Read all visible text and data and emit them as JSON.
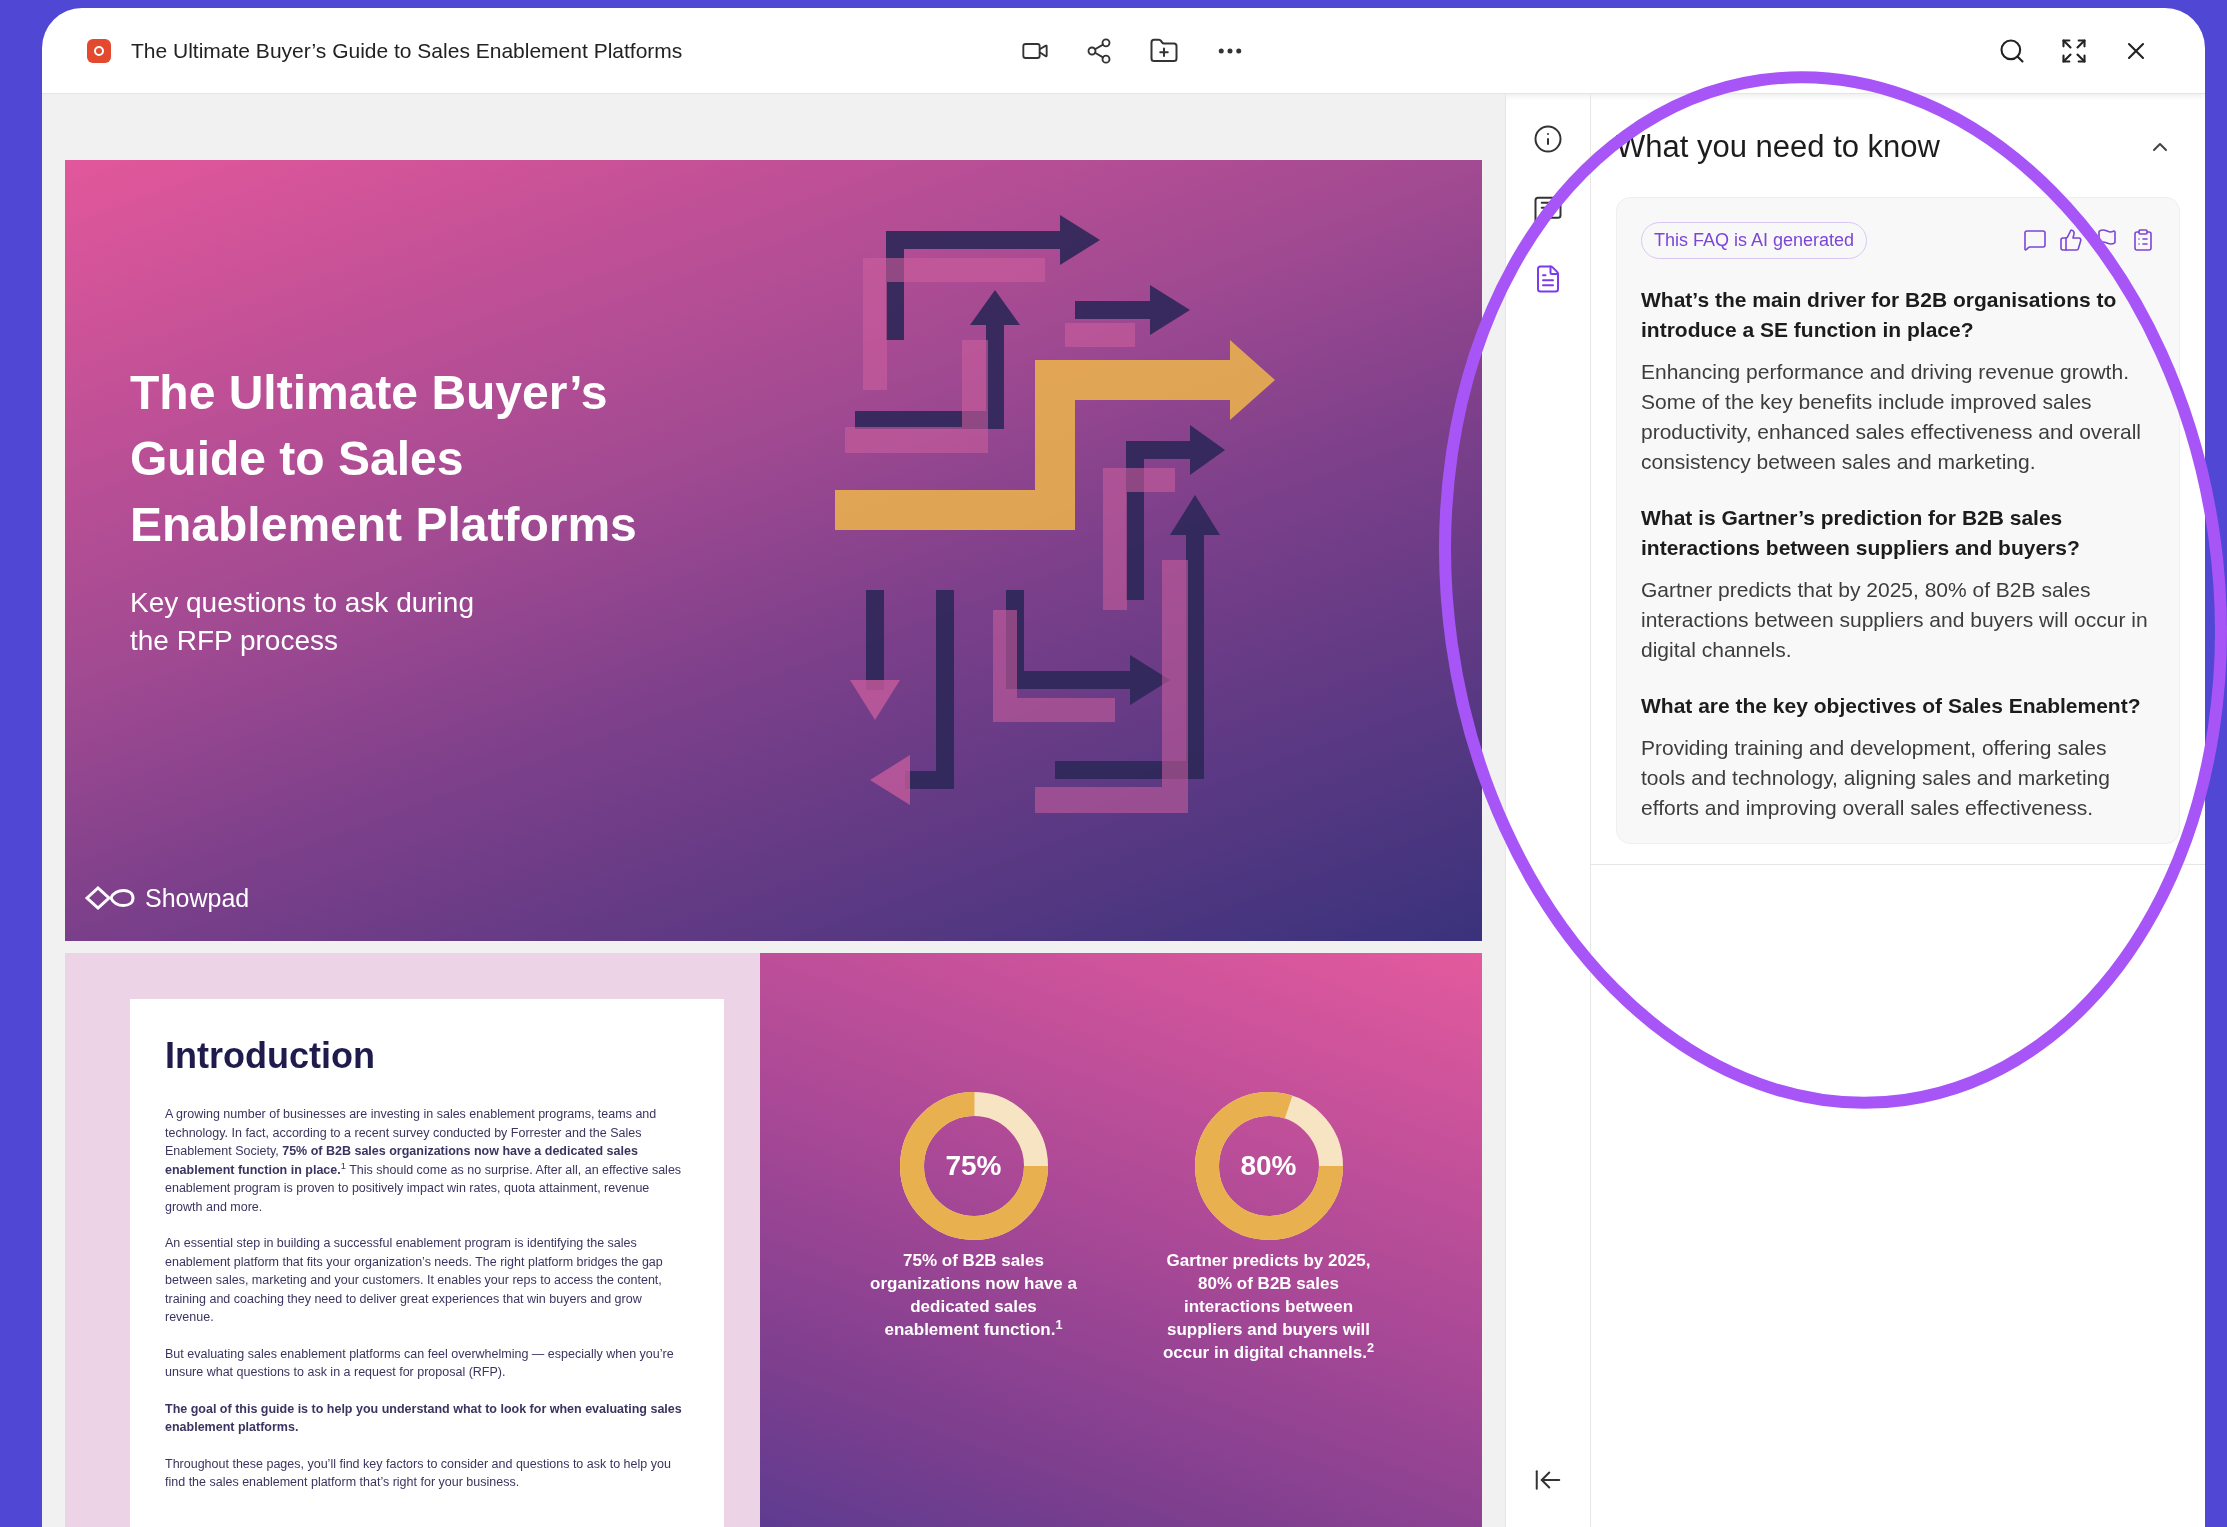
{
  "window": {
    "title": "The Ultimate Buyer’s Guide to Sales Enablement Platforms"
  },
  "document": {
    "cover": {
      "title_lines": [
        "The Ultimate Buyer’s",
        "Guide to Sales",
        "Enablement Platforms"
      ],
      "subtitle_lines": [
        "Key questions to ask during",
        "the RFP process"
      ],
      "brand": "Showpad"
    },
    "intro": {
      "heading": "Introduction",
      "paragraphs": [
        "A growing number of businesses are investing in sales enablement programs, teams and technology. In fact, according to a recent survey conducted by Forrester and the Sales Enablement Society, **75% of B2B sales organizations now have a dedicated sales enablement function in place.**$^{1}$ This should come as no surprise. After all, an effective sales enablement program is proven to positively impact win rates, quota attainment, revenue growth and more.",
        "An essential step in building a successful enablement program is identifying the sales enablement platform that fits your organization’s needs. The right platform bridges the gap between sales, marketing and your customers. It enables your reps to access the content, training and coaching they need to deliver great experiences that win buyers and grow revenue.",
        "But evaluating sales enablement platforms can feel overwhelming — especially when you’re unsure what questions to ask in a request for proposal (RFP).",
        "**The goal of this guide is to help you understand what to look for when evaluating sales enablement platforms.**",
        "Throughout these pages, you’ll find key factors to consider and questions to ask to help you find the sales enablement platform that’s right for your business."
      ]
    },
    "stats": [
      {
        "value": "75%",
        "level": 0.75,
        "caption": "75% of B2B sales organizations now have a dedicated sales enablement function.$^{1}$"
      },
      {
        "value": "80%",
        "level": 0.8,
        "caption": "Gartner predicts by 2025, 80% of B2B sales interactions between suppliers and buyers will occur in digital channels.$^{2}$"
      }
    ]
  },
  "panel": {
    "heading": "What you need to know",
    "expanded": true,
    "badge": "This FAQ is AI generated",
    "faqs": [
      {
        "question": "What’s the main driver for B2B organisations to introduce a SE function in place?",
        "answer": "Enhancing performance and driving revenue growth. Some of the key benefits include improved sales productivity, enhanced sales effectiveness and overall consistency between sales and marketing."
      },
      {
        "question": "What is Gartner’s prediction for B2B sales interactions between suppliers and buyers?",
        "answer": "Gartner predicts that by 2025, 80% of B2B sales interactions between suppliers and buyers will occur in digital channels."
      },
      {
        "question": "What are the key objectives of Sales Enablement?",
        "answer": "Providing training and development, offering sales tools and technology, aligning sales and marketing efforts and improving overall sales effectiveness."
      }
    ]
  }
}
